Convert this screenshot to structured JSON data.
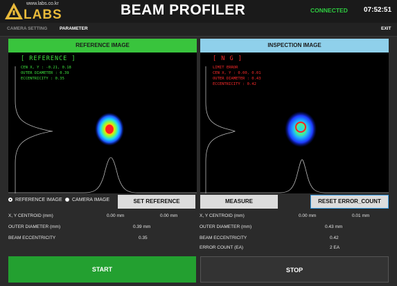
{
  "header": {
    "logo_url": "www.labs.co.kr",
    "logo_text": "LABS",
    "title": "BEAM PROFILER",
    "status": "CONNECTED",
    "time": "07:52:51",
    "status_color": "#2ecc40"
  },
  "menu": {
    "camera_setting": "CAMERA SETTING",
    "parameter": "PARAMETER",
    "exit": "EXIT"
  },
  "reference": {
    "header": "REFERENCE IMAGE",
    "tag": "[ REFERENCE ]",
    "cen": "CEN X, Y : -0.21, 0.18",
    "outer": "OUTER DIAMETER : 0.39",
    "ecc": "ECCENTRICITY : 0.35",
    "overlay_color": "#3ee03e"
  },
  "inspection": {
    "header": "INSPECTION IMAGE",
    "tag": "[ N G ]",
    "limit": "LIMIT ERROR",
    "cen": "CEN X, Y : 0.00, 0.01",
    "outer": "OUTER DIAMETER : 0.43",
    "ecc": "ECCENTRICITY : 0.42",
    "overlay_color": "#ff2b2b"
  },
  "controls": {
    "radio_reference": "REFERENCE IMAGE",
    "radio_camera": "CAMERA IMAGE",
    "set_reference": "SET REFERENCE",
    "measure": "MEASURE",
    "reset_error_count": "RESET ERROR_COUNT"
  },
  "ref_results": {
    "xy_label": "X, Y CENTROID (mm)",
    "x_val": "0.00 mm",
    "y_val": "0.00 mm",
    "outer_label": "OUTER DIAMETER (mm)",
    "outer_val": "0.39 mm",
    "ecc_label": "BEAM ECCENTRICITY",
    "ecc_val": "0.35"
  },
  "ins_results": {
    "xy_label": "X, Y CENTROID (mm)",
    "x_val": "0.00 mm",
    "y_val": "0.01 mm",
    "outer_label": "OUTER DIAMETER (mm)",
    "outer_val": "0.43 mm",
    "ecc_label": "BEAM ECCENTRICITY",
    "ecc_val": "0.42",
    "err_label": "ERROR COUNT (EA)",
    "err_val": "2 EA"
  },
  "actions": {
    "start": "START",
    "stop": "STOP",
    "start_color": "#23a030"
  }
}
